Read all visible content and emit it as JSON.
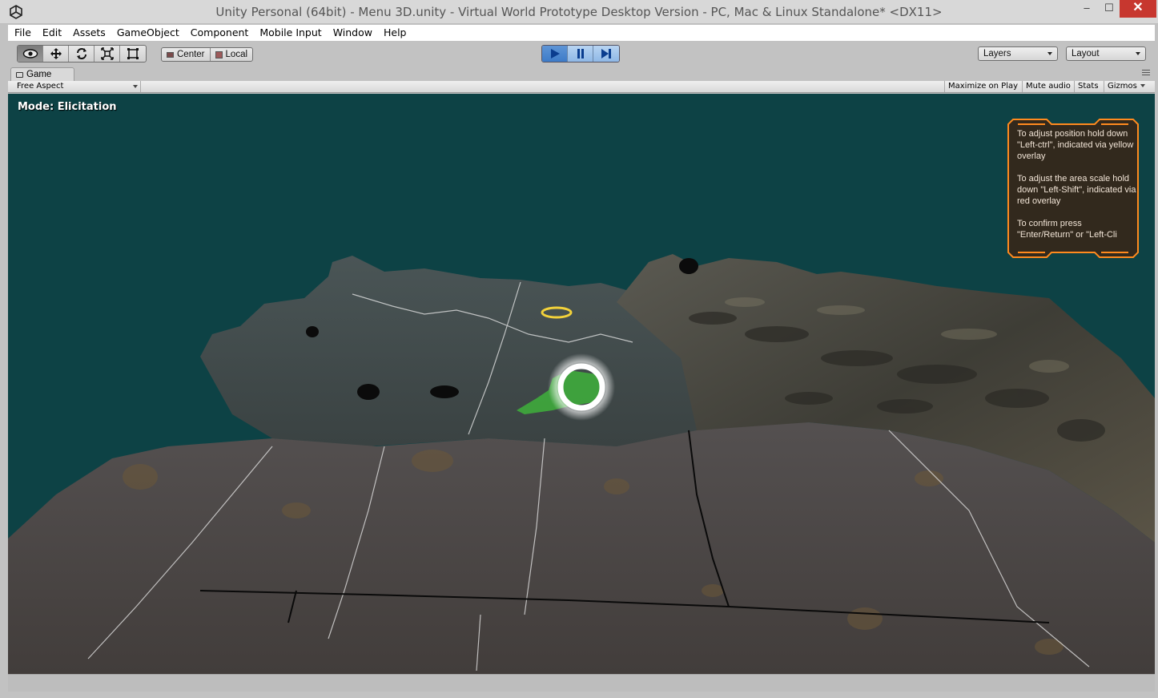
{
  "window": {
    "title": "Unity Personal (64bit) - Menu 3D.unity - Virtual World Prototype Desktop Version - PC, Mac & Linux Standalone* <DX11>",
    "minimize_glyph": "‒",
    "maximize_glyph": "☐",
    "close_glyph": "✕"
  },
  "menu": {
    "items": [
      "File",
      "Edit",
      "Assets",
      "GameObject",
      "Component",
      "Mobile Input",
      "Window",
      "Help"
    ]
  },
  "toolbar": {
    "tools": [
      "eye-icon",
      "move-icon",
      "rotate-icon",
      "scale-icon",
      "rect-tool-icon"
    ],
    "pivot_center_label": "Center",
    "pivot_local_label": "Local",
    "playback": [
      "play-icon",
      "pause-icon",
      "step-icon"
    ],
    "layers_label": "Layers",
    "layout_label": "Layout"
  },
  "game_tab": {
    "label": "Game",
    "aspect_label": "Free Aspect",
    "maximize_on_play_label": "Maximize on Play",
    "mute_audio_label": "Mute audio",
    "stats_label": "Stats",
    "gizmos_label": "Gizmos"
  },
  "viewport": {
    "mode_label": "Mode: Elicitation",
    "help_text": "To adjust position hold down \"Left-ctrl\", indicated via yellow overlay\n\nTo adjust the area scale hold down \"Left-Shift\", indicated via red overlay\n\nTo confirm press \"Enter/Return\" or \"Left-Cli",
    "colors": {
      "sky": "#0d4245",
      "panel_border": "#ff8a1e",
      "panel_fill": "#3a2416",
      "yellow_ring": "#f3d23a",
      "green_marker": "#3fbf3a"
    }
  }
}
